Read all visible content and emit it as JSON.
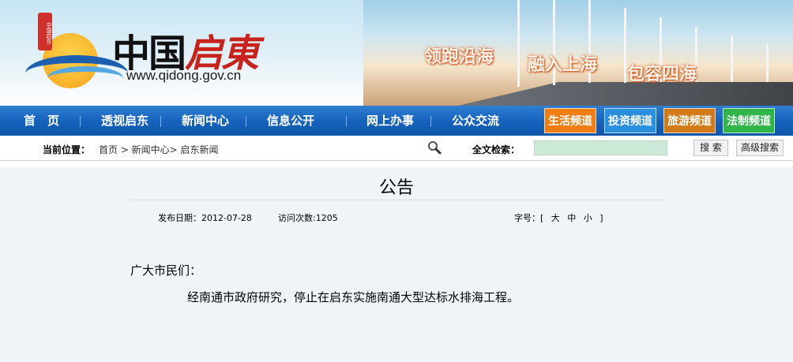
{
  "banner": {
    "seal_text": "中国启东",
    "logo_black": "中国",
    "logo_red": "启東",
    "url": "www.qidong.gov.cn",
    "slogans": [
      "领跑沿海",
      "融入上海",
      "包容四海"
    ]
  },
  "nav": {
    "items": [
      "首　页",
      "透视启东",
      "新闻中心",
      "信息公开",
      "网上办事",
      "公众交流"
    ],
    "channels": [
      {
        "label": "生活频道",
        "color": "#f07d12"
      },
      {
        "label": "投资频道",
        "color": "#2b8fe0"
      },
      {
        "label": "旅游频道",
        "color": "#d27a18"
      },
      {
        "label": "法制频道",
        "color": "#2fb54a"
      }
    ]
  },
  "location": {
    "label": "当前位置：",
    "breadcrumb": "首页 > 新闻中心> 启东新闻",
    "search_icon": "magnifier-icon",
    "search_label": "全文检索：",
    "search_value": "",
    "search_button": "搜 索",
    "advanced_button": "高级搜索"
  },
  "article": {
    "title": "公告",
    "publish_date": "发布日期：2012-07-28",
    "visits": "访问次数:1205",
    "font_size_label": "字号：[",
    "font_large": "大",
    "font_medium": "中",
    "font_small": "小",
    "font_close": "]",
    "greeting": "广大市民们：",
    "body": "经南通市政府研究，停止在启东实施南通大型达标水排海工程。"
  }
}
